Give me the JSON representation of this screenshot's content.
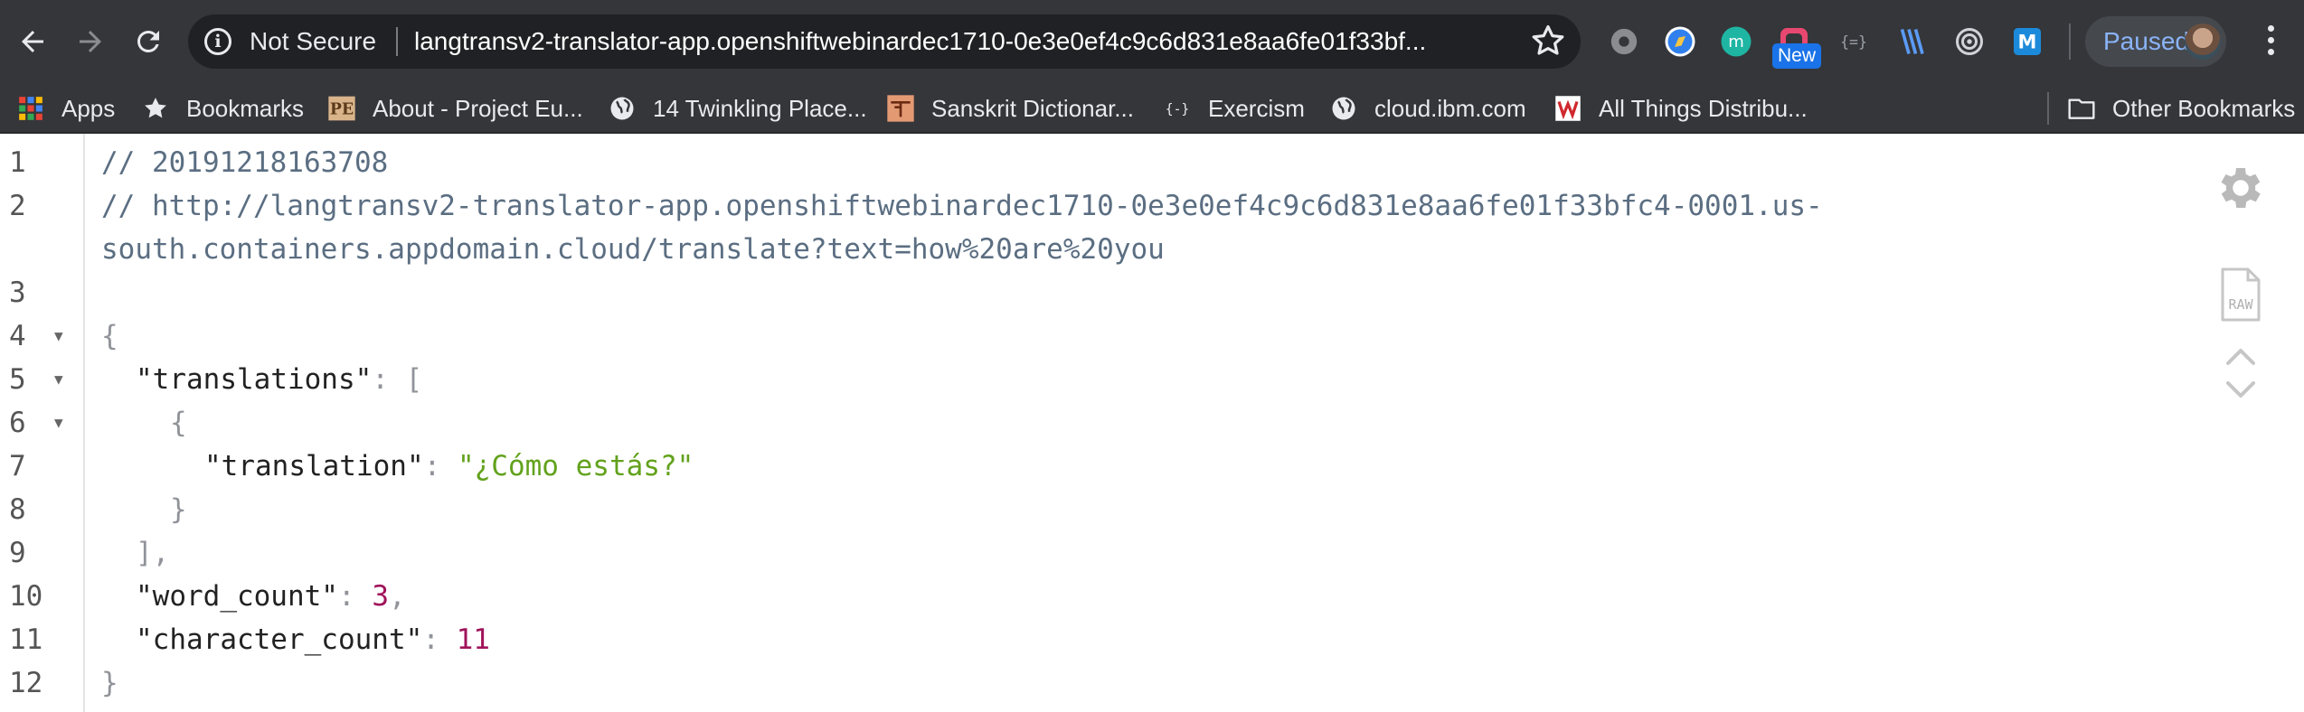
{
  "browser": {
    "security_label": "Not Secure",
    "url": "langtransv2-translator-app.openshiftwebinardec1710-0e3e0ef4c9c6d831e8aa6fe01f33bf...",
    "extension_badge": "New",
    "profile_label": "Paused"
  },
  "bookmarks": [
    {
      "label": "Apps",
      "icon": "apps-grid-icon"
    },
    {
      "label": "Bookmarks",
      "icon": "star-icon"
    },
    {
      "label": "About - Project Eu...",
      "icon": "project-euler-icon"
    },
    {
      "label": "14 Twinkling Place...",
      "icon": "globe-icon"
    },
    {
      "label": "Sanskrit Dictionar...",
      "icon": "sanskrit-dictionary-icon"
    },
    {
      "label": "Exercism",
      "icon": "exercism-icon"
    },
    {
      "label": "cloud.ibm.com",
      "icon": "globe-icon"
    },
    {
      "label": "All Things Distribu...",
      "icon": "all-things-distributed-icon"
    }
  ],
  "other_bookmarks": "Other Bookmarks",
  "json_viewer": {
    "line_numbers": [
      "1",
      "2",
      "3",
      "4",
      "5",
      "6",
      "7",
      "8",
      "9",
      "10",
      "11",
      "12"
    ],
    "comment_timestamp": "// 20191218163708",
    "comment_url_line1": "// http://langtransv2-translator-app.openshiftwebinardec1710-0e3e0ef4c9c6d831e8aa6fe01f33bfc4-0001.us-",
    "comment_url_line2": "south.containers.appdomain.cloud/translate?text=how%20are%20you",
    "open_brace": "{",
    "key_translations": "\"translations\"",
    "colon": ":",
    "open_bracket": "[",
    "inner_open_brace": "{",
    "key_translation": "\"translation\"",
    "value_translation": "\"¿Cómo estás?\"",
    "inner_close_brace": "}",
    "close_bracket_comma": "],",
    "key_word_count": "\"word_count\"",
    "value_word_count": "3",
    "comma": ",",
    "key_character_count": "\"character_count\"",
    "value_character_count": "11",
    "close_brace": "}",
    "raw_label": "RAW"
  },
  "colors": {
    "toolbar_bg": "#35363a",
    "omnibox_bg": "#202124",
    "comment": "#5b6e82",
    "string": "#62a21c",
    "number": "#a0135a"
  }
}
